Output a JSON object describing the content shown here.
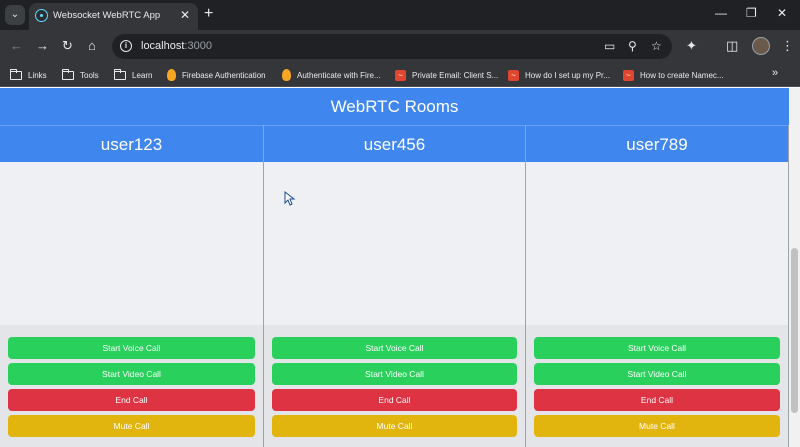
{
  "browser": {
    "tab_title": "Websocket WebRTC App",
    "url_host": "localhost",
    "url_port": ":3000",
    "bookmarks": [
      {
        "label": "Links",
        "icon": "folder-icon"
      },
      {
        "label": "Tools",
        "icon": "folder-icon"
      },
      {
        "label": "Learn",
        "icon": "folder-icon"
      },
      {
        "label": "Firebase Authentication",
        "icon": "firebase-icon"
      },
      {
        "label": "Authenticate with Fire...",
        "icon": "firebase-icon"
      },
      {
        "label": "Private Email: Client S...",
        "icon": "zoho-icon"
      },
      {
        "label": "How do I set up my Pr...",
        "icon": "zoho-icon"
      },
      {
        "label": "How to create Namec...",
        "icon": "zoho-icon"
      }
    ]
  },
  "app": {
    "title": "WebRTC Rooms",
    "rooms": [
      {
        "user": "user123"
      },
      {
        "user": "user456"
      },
      {
        "user": "user789"
      }
    ],
    "buttons": {
      "voice": "Start Voice Call",
      "video": "Start Video Call",
      "end": "End Call",
      "mute": "Mute Call"
    }
  },
  "colors": {
    "primary": "#3f86ee",
    "green": "#2ad05c",
    "red": "#dd3343",
    "yellow": "#e2b50e"
  }
}
